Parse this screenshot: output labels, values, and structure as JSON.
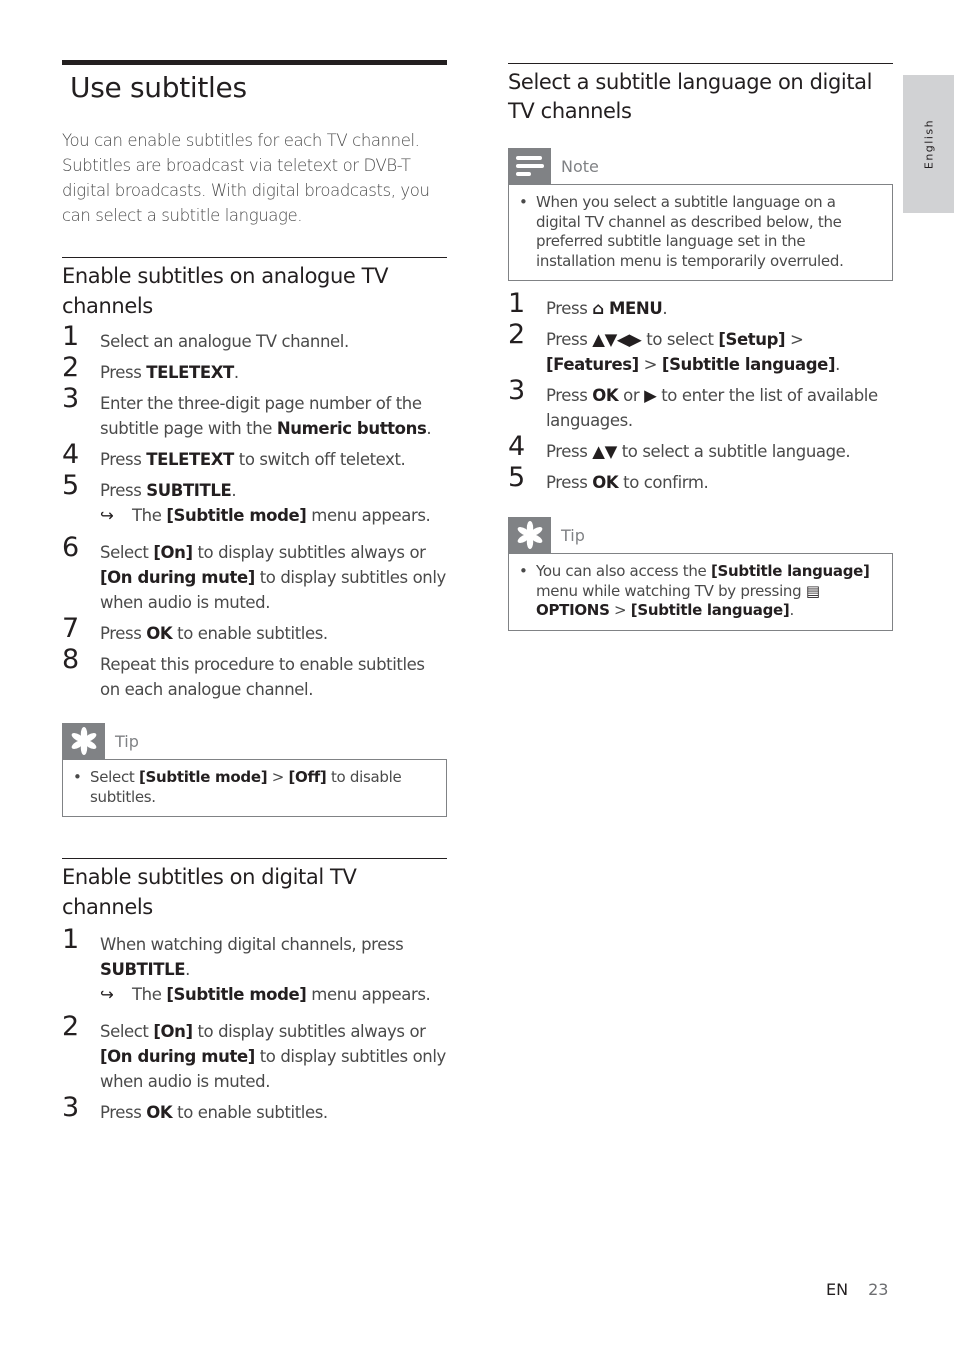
{
  "side_tab": {
    "label": "English"
  },
  "left": {
    "title": "Use subtitles",
    "intro": "You can enable subtitles for each TV channel. Subtitles are broadcast via teletext or DVB-T digital broadcasts. With digital broadcasts, you can select a subtitle language.",
    "analogue": {
      "heading": "Enable subtitles on analogue TV channels",
      "steps": [
        {
          "n": "1",
          "parts": [
            {
              "t": "Select an analogue TV channel."
            }
          ]
        },
        {
          "n": "2",
          "parts": [
            {
              "t": "Press "
            },
            {
              "b": "TELETEXT"
            },
            {
              "t": "."
            }
          ]
        },
        {
          "n": "3",
          "parts": [
            {
              "t": "Enter the three-digit page number of the subtitle page with the "
            },
            {
              "b": "Numeric buttons"
            },
            {
              "t": "."
            }
          ]
        },
        {
          "n": "4",
          "parts": [
            {
              "t": "Press "
            },
            {
              "b": "TELETEXT"
            },
            {
              "t": " to switch off teletext."
            }
          ]
        },
        {
          "n": "5",
          "parts": [
            {
              "t": "Press "
            },
            {
              "b": "SUBTITLE"
            },
            {
              "t": "."
            }
          ],
          "sub": [
            {
              "t": "The "
            },
            {
              "b": "[Subtitle mode]"
            },
            {
              "t": " menu appears."
            }
          ]
        },
        {
          "n": "6",
          "parts": [
            {
              "t": "Select "
            },
            {
              "b": "[On]"
            },
            {
              "t": " to display subtitles always or "
            },
            {
              "b": "[On during mute]"
            },
            {
              "t": " to display subtitles only when audio is muted."
            }
          ]
        },
        {
          "n": "7",
          "parts": [
            {
              "t": "Press "
            },
            {
              "b": "OK"
            },
            {
              "t": " to enable subtitles."
            }
          ]
        },
        {
          "n": "8",
          "parts": [
            {
              "t": "Repeat this procedure to enable subtitles on each analogue channel."
            }
          ]
        }
      ],
      "tip": {
        "title": "Tip",
        "parts": [
          {
            "t": "Select "
          },
          {
            "b": "[Subtitle mode]"
          },
          {
            "t": " > "
          },
          {
            "b": "[Off]"
          },
          {
            "t": " to disable subtitles."
          }
        ]
      }
    },
    "digital": {
      "heading": "Enable subtitles on digital TV channels",
      "steps": [
        {
          "n": "1",
          "parts": [
            {
              "t": "When watching digital channels, press "
            },
            {
              "b": "SUBTITLE"
            },
            {
              "t": "."
            }
          ],
          "sub": [
            {
              "t": "The "
            },
            {
              "b": "[Subtitle mode]"
            },
            {
              "t": " menu appears."
            }
          ]
        },
        {
          "n": "2",
          "parts": [
            {
              "t": "Select "
            },
            {
              "b": "[On]"
            },
            {
              "t": " to display subtitles always or "
            },
            {
              "b": "[On during mute]"
            },
            {
              "t": " to display subtitles only when audio is muted."
            }
          ]
        },
        {
          "n": "3",
          "parts": [
            {
              "t": "Press "
            },
            {
              "b": "OK"
            },
            {
              "t": " to enable subtitles."
            }
          ]
        }
      ]
    }
  },
  "right": {
    "heading": "Select a subtitle language on digital TV channels",
    "note": {
      "title": "Note",
      "parts": [
        {
          "t": "When you select a subtitle language on a digital TV channel as described below, the preferred subtitle language set in the installation menu is temporarily overruled."
        }
      ]
    },
    "steps": [
      {
        "n": "1",
        "parts": [
          {
            "t": "Press "
          },
          {
            "b": "⌂ MENU"
          },
          {
            "t": "."
          }
        ]
      },
      {
        "n": "2",
        "parts": [
          {
            "t": "Press "
          },
          {
            "b": "▲▼◀▶"
          },
          {
            "t": " to select "
          },
          {
            "b": "[Setup]"
          },
          {
            "t": " > "
          },
          {
            "b": "[Features]"
          },
          {
            "t": " > "
          },
          {
            "b": "[Subtitle language]"
          },
          {
            "t": "."
          }
        ]
      },
      {
        "n": "3",
        "parts": [
          {
            "t": "Press "
          },
          {
            "b": "OK"
          },
          {
            "t": " or "
          },
          {
            "b": "▶"
          },
          {
            "t": " to enter the list of available languages."
          }
        ]
      },
      {
        "n": "4",
        "parts": [
          {
            "t": "Press "
          },
          {
            "b": "▲▼"
          },
          {
            "t": " to select a subtitle language."
          }
        ]
      },
      {
        "n": "5",
        "parts": [
          {
            "t": "Press "
          },
          {
            "b": "OK"
          },
          {
            "t": " to confirm."
          }
        ]
      }
    ],
    "tip": {
      "title": "Tip",
      "parts": [
        {
          "t": "You can also access the "
        },
        {
          "b": "[Subtitle language]"
        },
        {
          "t": " menu while watching TV by pressing "
        },
        {
          "b": "▤ OPTIONS"
        },
        {
          "t": " > "
        },
        {
          "b": "[Subtitle language]"
        },
        {
          "t": "."
        }
      ]
    }
  },
  "footer": {
    "lang": "EN",
    "page": "23"
  }
}
